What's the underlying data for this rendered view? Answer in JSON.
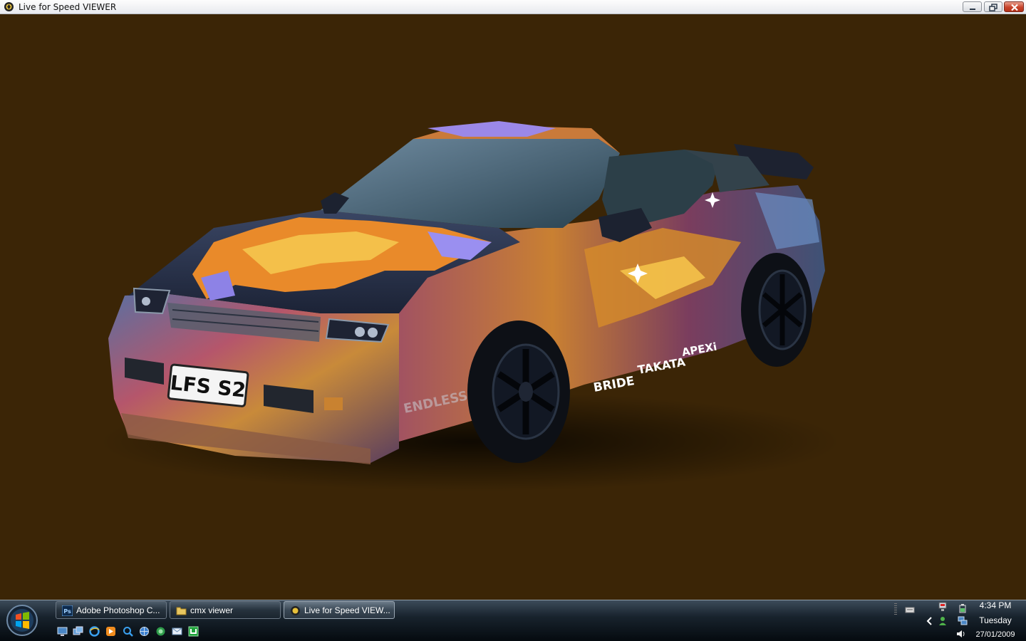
{
  "window": {
    "title": "Live for Speed VIEWER",
    "buttons": {
      "minimize": "minimize",
      "maximize": "restore",
      "close": "close"
    }
  },
  "viewport": {
    "background_color": "#3b2506",
    "car": {
      "plate_text": "LFS S2",
      "sponsor_decals": [
        "BRIDE",
        "TAKATA",
        "APEXi"
      ],
      "bumper_decal": "ENDLESS"
    }
  },
  "taskbar": {
    "start_button": "start-orb",
    "windows": [
      {
        "label": "Adobe Photoshop C...",
        "icon": "photoshop-icon",
        "active": false
      },
      {
        "label": "cmx viewer",
        "icon": "folder-icon",
        "active": false
      },
      {
        "label": "Live for Speed VIEW...",
        "icon": "lfs-icon",
        "active": true
      }
    ],
    "quick_launch": [
      "show-desktop-icon",
      "switch-windows-icon",
      "ie-icon",
      "media-player-icon",
      "search-icon",
      "globe-icon",
      "network-icon",
      "mail-icon",
      "app-icon"
    ],
    "tray": {
      "icons": [
        "keyboard-icon",
        "expand-chevron-icon",
        "network-tray-icon",
        "messenger-icon",
        "volume-icon",
        "power-icon"
      ],
      "time": "4:34 PM",
      "day": "Tuesday",
      "date": "27/01/2009"
    }
  }
}
